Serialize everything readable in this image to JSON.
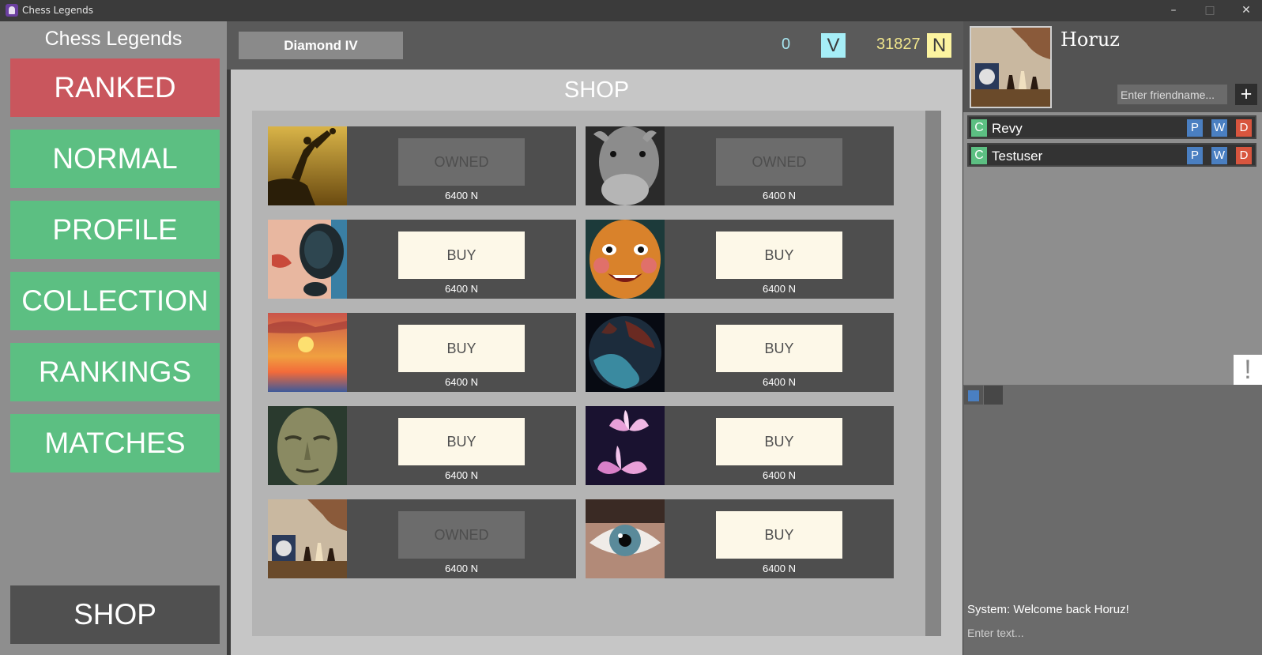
{
  "window": {
    "title": "Chess Legends",
    "minimize": "–",
    "maximize": "□",
    "close": "✕"
  },
  "sidebar": {
    "title": "Chess Legends",
    "buttons": [
      "RANKED",
      "NORMAL",
      "PROFILE",
      "COLLECTION",
      "RANKINGS",
      "MATCHES"
    ],
    "shop_label": "SHOP"
  },
  "topbar": {
    "rank": "Diamond IV",
    "v_count": "0",
    "v_label": "V",
    "n_count": "31827",
    "n_label": "N"
  },
  "shop": {
    "title": "SHOP",
    "items": [
      {
        "action": "OWNED",
        "price": "6400 N",
        "thumb": "climbers-silhouette"
      },
      {
        "action": "OWNED",
        "price": "6400 N",
        "thumb": "camel-bw"
      },
      {
        "action": "BUY",
        "price": "6400 N",
        "thumb": "sunglasses-face"
      },
      {
        "action": "BUY",
        "price": "6400 N",
        "thumb": "carved-mask"
      },
      {
        "action": "BUY",
        "price": "6400 N",
        "thumb": "sunset"
      },
      {
        "action": "BUY",
        "price": "6400 N",
        "thumb": "planet"
      },
      {
        "action": "BUY",
        "price": "6400 N",
        "thumb": "stone-face"
      },
      {
        "action": "BUY",
        "price": "6400 N",
        "thumb": "lotus"
      },
      {
        "action": "OWNED",
        "price": "6400 N",
        "thumb": "chess-clock"
      },
      {
        "action": "BUY",
        "price": "6400 N",
        "thumb": "eye"
      }
    ]
  },
  "profile": {
    "username": "Horuz",
    "friend_placeholder": "Enter friendname...",
    "add_label": "+"
  },
  "friends": [
    {
      "status": "C",
      "name": "Revy",
      "p": "P",
      "w": "W",
      "d": "D"
    },
    {
      "status": "C",
      "name": "Testuser",
      "p": "P",
      "w": "W",
      "d": "D"
    }
  ],
  "notify_label": "!",
  "chat": {
    "message": "System: Welcome back Horuz!",
    "placeholder": "Enter text..."
  },
  "colors": {
    "ranked": "#c9565d",
    "nav": "#5cbf82",
    "buy_bg": "#fdf8e8",
    "owned_bg": "#6c6c6c",
    "v_accent": "#a6eef7",
    "n_accent": "#fcf4a0"
  }
}
